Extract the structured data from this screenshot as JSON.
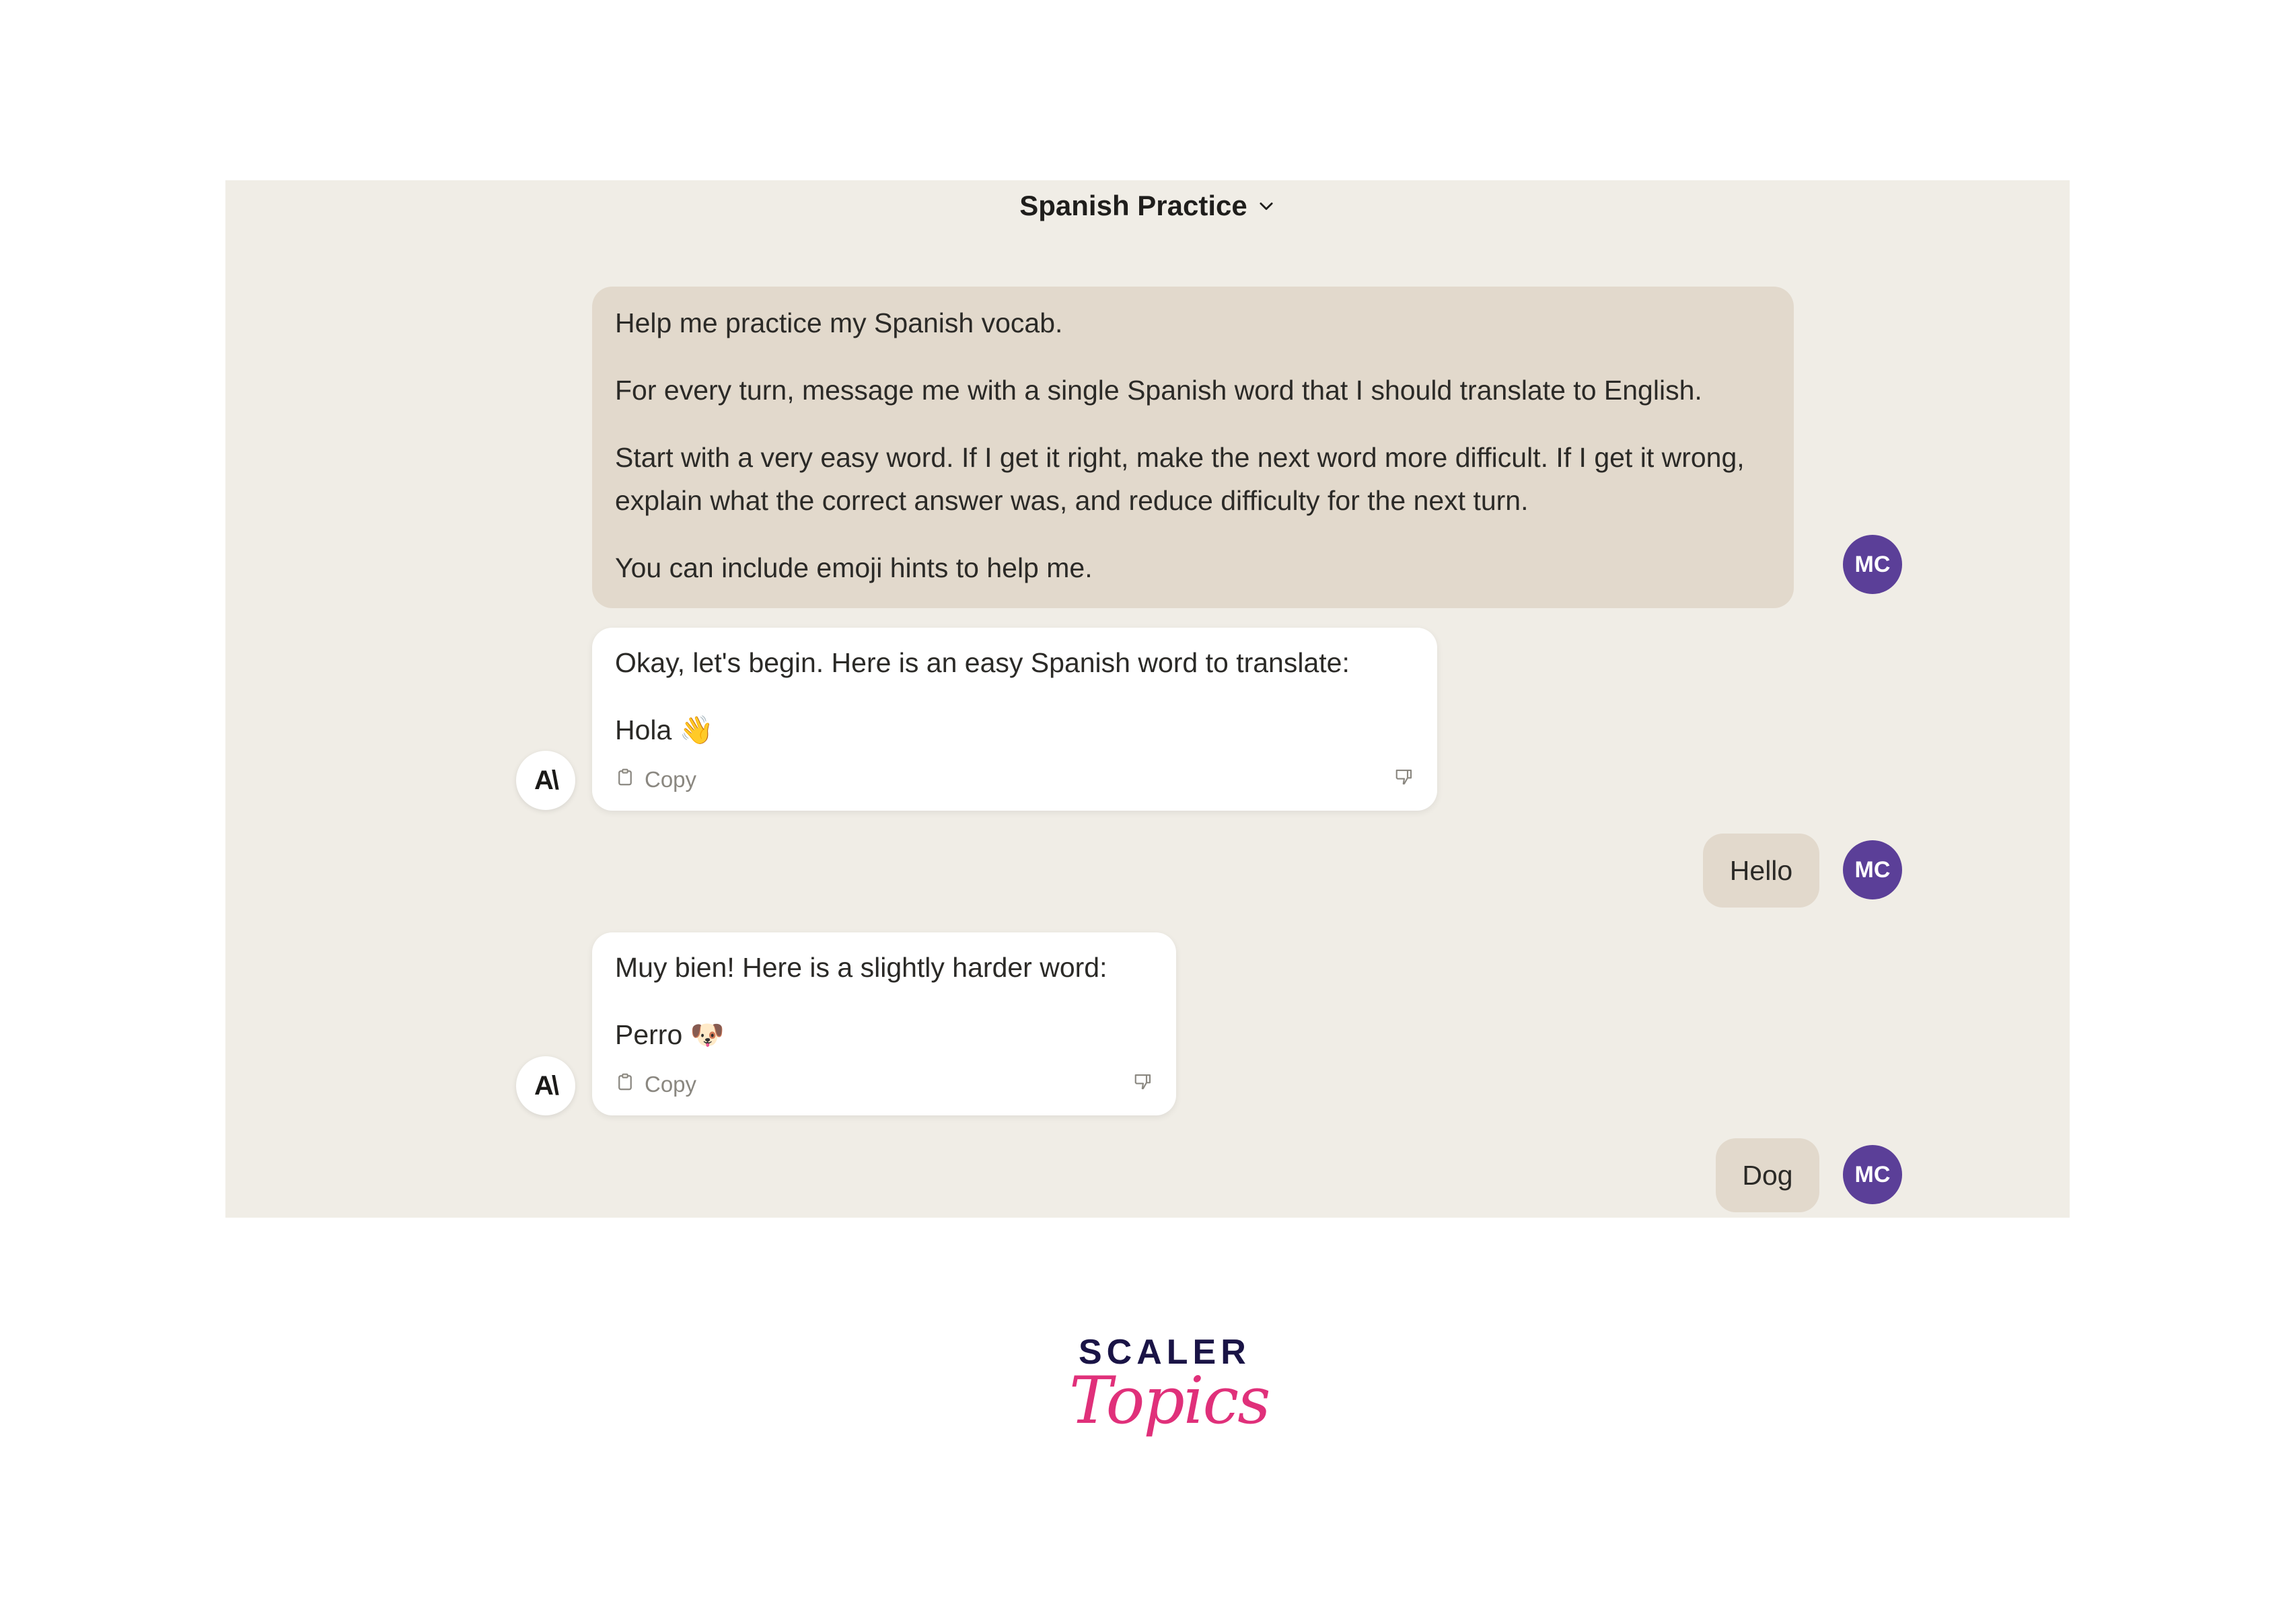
{
  "header": {
    "title": "Spanish Practice",
    "chevron_icon": "chevron-down-icon"
  },
  "user": {
    "initials": "MC",
    "avatar_color": "#5b3f98"
  },
  "assistant": {
    "logo_text": "A\\"
  },
  "messages": [
    {
      "role": "user",
      "paragraphs": [
        "Help me practice my Spanish vocab.",
        "For every turn, message me with a single Spanish word that I should translate to English.",
        "Start with a very easy word. If I get it right, make the next word more difficult. If I get it wrong, explain what the correct answer was, and reduce difficulty for the next turn.",
        "You can include emoji hints to help me."
      ]
    },
    {
      "role": "assistant",
      "paragraphs": [
        "Okay, let's begin. Here is an easy Spanish word to translate:",
        "Hola 👋"
      ],
      "copy_label": "Copy"
    },
    {
      "role": "user",
      "text": "Hello"
    },
    {
      "role": "assistant",
      "paragraphs": [
        "Muy bien! Here is a slightly harder word:",
        "Perro 🐶"
      ],
      "copy_label": "Copy"
    },
    {
      "role": "user",
      "text": "Dog"
    }
  ],
  "branding": {
    "line1": "SCALER",
    "line2": "Topics",
    "colors": {
      "line1": "#1a1446",
      "line2": "#e0307a"
    }
  }
}
